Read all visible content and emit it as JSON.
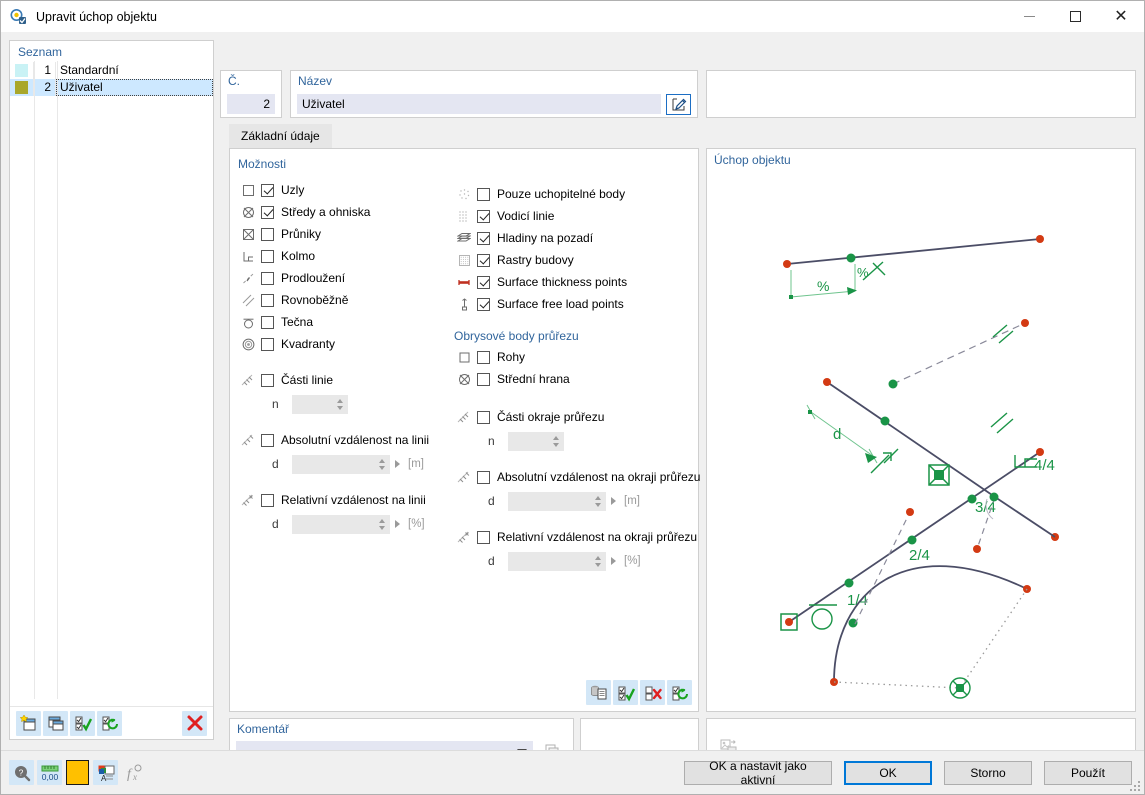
{
  "window": {
    "title": "Upravit úchop objektu",
    "icon": "object-snap-icon",
    "controls": {
      "minimize": "minimize-icon",
      "maximize": "maximize-icon",
      "close": "close-icon"
    }
  },
  "list_panel": {
    "caption": "Seznam",
    "columns": [
      "color",
      "no",
      "name"
    ],
    "rows": [
      {
        "color": "#c9f2f5",
        "no": "1",
        "name": "Standardní",
        "selected": false
      },
      {
        "color": "#a9a72b",
        "no": "2",
        "name": "Uživatel",
        "selected": true
      }
    ],
    "toolbar": [
      {
        "name": "new-item-button",
        "icon": "new-window-star-icon"
      },
      {
        "name": "copy-item-button",
        "icon": "copy-window-icon"
      },
      {
        "name": "check-all-button",
        "icon": "check-list-green-icon"
      },
      {
        "name": "refresh-list-button",
        "icon": "check-list-refresh-icon"
      },
      {
        "name": "delete-item-button",
        "icon": "red-x-icon"
      }
    ]
  },
  "header": {
    "number_label": "Č.",
    "number_value": "2",
    "name_label": "Název",
    "name_value": "Uživatel",
    "name_edit_icon": "pencil-edit-icon"
  },
  "tabs": [
    {
      "label": "Základní údaje",
      "active": true
    }
  ],
  "options": {
    "group_title": "Možnosti",
    "left_items": [
      {
        "pic": "node-point-icon",
        "label": "Uzly",
        "checked": true
      },
      {
        "pic": "center-focus-icon",
        "label": "Středy a ohniska",
        "checked": true
      },
      {
        "pic": "intersection-icon",
        "label": "Průniky",
        "checked": false
      },
      {
        "pic": "perpendicular-icon",
        "label": "Kolmo",
        "checked": false
      },
      {
        "pic": "extension-icon",
        "label": "Prodloužení",
        "checked": false
      },
      {
        "pic": "parallel-icon",
        "label": "Rovnoběžně",
        "checked": false
      },
      {
        "pic": "tangent-icon",
        "label": "Tečna",
        "checked": false
      },
      {
        "pic": "quadrant-icon",
        "label": "Kvadranty",
        "checked": false
      }
    ],
    "left_groups": [
      {
        "pic": "line-parts-icon",
        "label": "Části linie",
        "checked": false,
        "field_label": "n",
        "field_value": "",
        "unit": ""
      },
      {
        "pic": "abs-distance-icon",
        "label": "Absolutní vzdálenost na linii",
        "checked": false,
        "field_label": "d",
        "field_value": "",
        "unit": "[m]"
      },
      {
        "pic": "rel-distance-icon",
        "label": "Relativní vzdálenost na linii",
        "checked": false,
        "field_label": "d",
        "field_value": "",
        "unit": "[%]"
      }
    ],
    "right_items": [
      {
        "pic": "snappable-points-icon",
        "label": "Pouze uchopitelné body",
        "checked": false
      },
      {
        "pic": "guide-lines-icon",
        "label": "Vodicí linie",
        "checked": true
      },
      {
        "pic": "background-layers-icon",
        "label": "Hladiny na pozadí",
        "checked": true
      },
      {
        "pic": "building-grids-icon",
        "label": "Rastry budovy",
        "checked": true
      },
      {
        "pic": "surface-thickness-icon",
        "label": "Surface thickness points",
        "checked": true
      },
      {
        "pic": "surface-free-load-icon",
        "label": "Surface free load points",
        "checked": true
      }
    ],
    "right_subgroup_title": "Obrysové body průřezu",
    "right_subgroup_items": [
      {
        "pic": "corners-icon",
        "label": "Rohy",
        "checked": false
      },
      {
        "pic": "middle-edge-icon",
        "label": "Střední hrana",
        "checked": false
      }
    ],
    "right_groups": [
      {
        "pic": "section-edge-parts-icon",
        "label": "Části okraje průřezu",
        "checked": false,
        "field_label": "n",
        "field_value": "",
        "unit": ""
      },
      {
        "pic": "abs-distance-edge-icon",
        "label": "Absolutní vzdálenost na okraji průřezu",
        "checked": false,
        "field_label": "d",
        "field_value": "",
        "unit": "[m]"
      },
      {
        "pic": "rel-distance-edge-icon",
        "label": "Relativní vzdálenost na okraji průřezu",
        "checked": false,
        "field_label": "d",
        "field_value": "",
        "unit": "[%]"
      }
    ],
    "toolbar": [
      {
        "name": "import-from-library-button",
        "icon": "database-document-icon"
      },
      {
        "name": "select-all-button",
        "icon": "check-all-green-icon"
      },
      {
        "name": "deselect-all-button",
        "icon": "uncheck-all-red-icon"
      },
      {
        "name": "reset-selection-button",
        "icon": "check-refresh-icon"
      }
    ]
  },
  "comment": {
    "label": "Komentář",
    "value": "",
    "placeholder": "",
    "copy_icon": "copy-icon"
  },
  "graphics": {
    "caption": "Úchop objektu",
    "annotations": [
      "%",
      "%",
      "d",
      "1/4",
      "2/4",
      "3/4",
      "4/4"
    ],
    "export_icon": "export-image-icon",
    "colors": {
      "line": "#4b4d66",
      "snap": "#1a9447",
      "node": "#d33a13"
    }
  },
  "footer": {
    "left_tools": [
      {
        "name": "help-button",
        "icon": "help-magnifier-icon"
      },
      {
        "name": "units-button",
        "icon": "units-ruler-icon"
      },
      {
        "name": "color-button",
        "icon": "color-swatch-icon",
        "color": "#ffc000"
      },
      {
        "name": "display-properties-button",
        "icon": "display-props-icon"
      },
      {
        "name": "formula-button",
        "icon": "function-icon"
      }
    ],
    "buttons": [
      {
        "name": "ok-and-set-active-button",
        "label": "OK a nastavit jako aktivní",
        "style": "wide"
      },
      {
        "name": "ok-button",
        "label": "OK",
        "style": "default"
      },
      {
        "name": "cancel-button",
        "label": "Storno",
        "style": "std"
      },
      {
        "name": "apply-button",
        "label": "Použít",
        "style": "std"
      }
    ]
  }
}
